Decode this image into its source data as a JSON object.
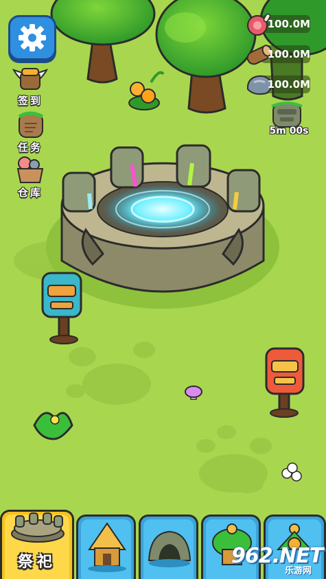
{
  "resources": [
    {
      "id": "meat",
      "icon": "meat-icon",
      "value": "100.0M"
    },
    {
      "id": "wood",
      "icon": "wood-log-icon",
      "value": "100.0M"
    },
    {
      "id": "stone",
      "icon": "stone-icon",
      "value": "100.0M"
    }
  ],
  "timer": {
    "icon": "totem-head-icon",
    "text": "5m 00s"
  },
  "side_menu": {
    "checkin_label": "签到",
    "tasks_label": "任务",
    "warehouse_label": "仓库"
  },
  "bottom_tabs": {
    "sacrifice_label": "祭祀",
    "tabs": [
      {
        "id": "sacrifice",
        "icon": "altar-icon"
      },
      {
        "id": "hut",
        "icon": "straw-hut-icon"
      },
      {
        "id": "cave",
        "icon": "cave-icon"
      },
      {
        "id": "tree-hut",
        "icon": "tree-hut-icon"
      },
      {
        "id": "granary",
        "icon": "granary-icon"
      }
    ]
  },
  "watermark": {
    "num": "962.NET",
    "sub": "乐游网"
  },
  "colors": {
    "grass": "#a9d64f",
    "tab_blue": "#4fc0ef",
    "tab_active": "#ffd84a",
    "portal": "#6ff0ff"
  }
}
